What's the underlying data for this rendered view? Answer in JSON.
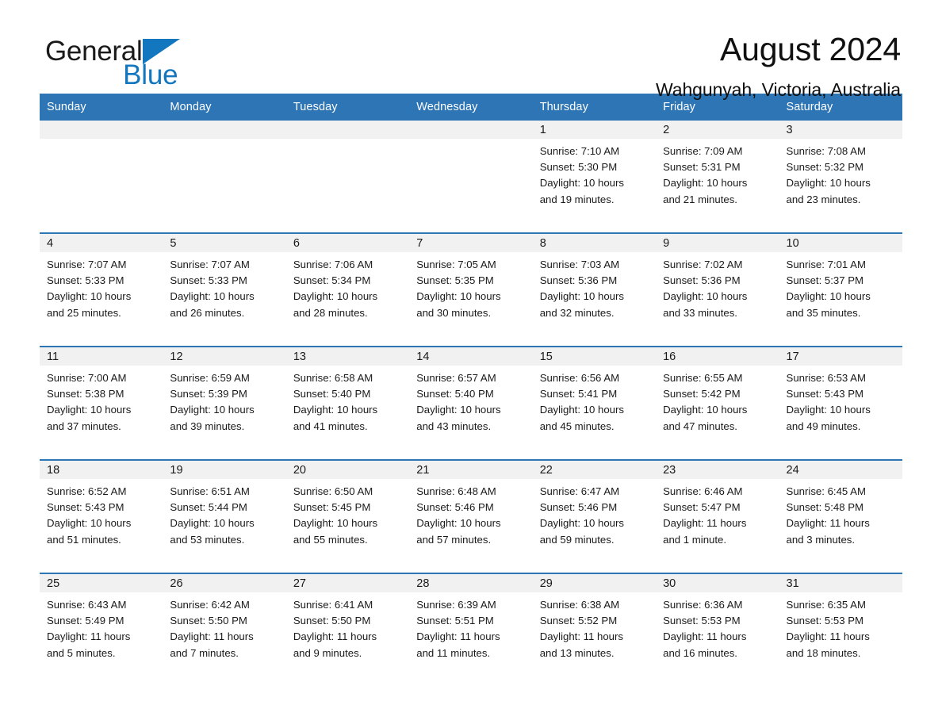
{
  "brand": {
    "name_part1": "General",
    "name_part2": "Blue",
    "triangle_color": "#1277be",
    "accent_color": "#2e75b6"
  },
  "header": {
    "month_title": "August 2024",
    "location": "Wahgunyah, Victoria, Australia"
  },
  "weekdays": [
    "Sunday",
    "Monday",
    "Tuesday",
    "Wednesday",
    "Thursday",
    "Friday",
    "Saturday"
  ],
  "weeks": [
    [
      {
        "day": "",
        "empty": true
      },
      {
        "day": "",
        "empty": true
      },
      {
        "day": "",
        "empty": true
      },
      {
        "day": "",
        "empty": true
      },
      {
        "day": "1",
        "sunrise": "Sunrise: 7:10 AM",
        "sunset": "Sunset: 5:30 PM",
        "daylight_line1": "Daylight: 10 hours",
        "daylight_line2": "and 19 minutes."
      },
      {
        "day": "2",
        "sunrise": "Sunrise: 7:09 AM",
        "sunset": "Sunset: 5:31 PM",
        "daylight_line1": "Daylight: 10 hours",
        "daylight_line2": "and 21 minutes."
      },
      {
        "day": "3",
        "sunrise": "Sunrise: 7:08 AM",
        "sunset": "Sunset: 5:32 PM",
        "daylight_line1": "Daylight: 10 hours",
        "daylight_line2": "and 23 minutes."
      }
    ],
    [
      {
        "day": "4",
        "sunrise": "Sunrise: 7:07 AM",
        "sunset": "Sunset: 5:33 PM",
        "daylight_line1": "Daylight: 10 hours",
        "daylight_line2": "and 25 minutes."
      },
      {
        "day": "5",
        "sunrise": "Sunrise: 7:07 AM",
        "sunset": "Sunset: 5:33 PM",
        "daylight_line1": "Daylight: 10 hours",
        "daylight_line2": "and 26 minutes."
      },
      {
        "day": "6",
        "sunrise": "Sunrise: 7:06 AM",
        "sunset": "Sunset: 5:34 PM",
        "daylight_line1": "Daylight: 10 hours",
        "daylight_line2": "and 28 minutes."
      },
      {
        "day": "7",
        "sunrise": "Sunrise: 7:05 AM",
        "sunset": "Sunset: 5:35 PM",
        "daylight_line1": "Daylight: 10 hours",
        "daylight_line2": "and 30 minutes."
      },
      {
        "day": "8",
        "sunrise": "Sunrise: 7:03 AM",
        "sunset": "Sunset: 5:36 PM",
        "daylight_line1": "Daylight: 10 hours",
        "daylight_line2": "and 32 minutes."
      },
      {
        "day": "9",
        "sunrise": "Sunrise: 7:02 AM",
        "sunset": "Sunset: 5:36 PM",
        "daylight_line1": "Daylight: 10 hours",
        "daylight_line2": "and 33 minutes."
      },
      {
        "day": "10",
        "sunrise": "Sunrise: 7:01 AM",
        "sunset": "Sunset: 5:37 PM",
        "daylight_line1": "Daylight: 10 hours",
        "daylight_line2": "and 35 minutes."
      }
    ],
    [
      {
        "day": "11",
        "sunrise": "Sunrise: 7:00 AM",
        "sunset": "Sunset: 5:38 PM",
        "daylight_line1": "Daylight: 10 hours",
        "daylight_line2": "and 37 minutes."
      },
      {
        "day": "12",
        "sunrise": "Sunrise: 6:59 AM",
        "sunset": "Sunset: 5:39 PM",
        "daylight_line1": "Daylight: 10 hours",
        "daylight_line2": "and 39 minutes."
      },
      {
        "day": "13",
        "sunrise": "Sunrise: 6:58 AM",
        "sunset": "Sunset: 5:40 PM",
        "daylight_line1": "Daylight: 10 hours",
        "daylight_line2": "and 41 minutes."
      },
      {
        "day": "14",
        "sunrise": "Sunrise: 6:57 AM",
        "sunset": "Sunset: 5:40 PM",
        "daylight_line1": "Daylight: 10 hours",
        "daylight_line2": "and 43 minutes."
      },
      {
        "day": "15",
        "sunrise": "Sunrise: 6:56 AM",
        "sunset": "Sunset: 5:41 PM",
        "daylight_line1": "Daylight: 10 hours",
        "daylight_line2": "and 45 minutes."
      },
      {
        "day": "16",
        "sunrise": "Sunrise: 6:55 AM",
        "sunset": "Sunset: 5:42 PM",
        "daylight_line1": "Daylight: 10 hours",
        "daylight_line2": "and 47 minutes."
      },
      {
        "day": "17",
        "sunrise": "Sunrise: 6:53 AM",
        "sunset": "Sunset: 5:43 PM",
        "daylight_line1": "Daylight: 10 hours",
        "daylight_line2": "and 49 minutes."
      }
    ],
    [
      {
        "day": "18",
        "sunrise": "Sunrise: 6:52 AM",
        "sunset": "Sunset: 5:43 PM",
        "daylight_line1": "Daylight: 10 hours",
        "daylight_line2": "and 51 minutes."
      },
      {
        "day": "19",
        "sunrise": "Sunrise: 6:51 AM",
        "sunset": "Sunset: 5:44 PM",
        "daylight_line1": "Daylight: 10 hours",
        "daylight_line2": "and 53 minutes."
      },
      {
        "day": "20",
        "sunrise": "Sunrise: 6:50 AM",
        "sunset": "Sunset: 5:45 PM",
        "daylight_line1": "Daylight: 10 hours",
        "daylight_line2": "and 55 minutes."
      },
      {
        "day": "21",
        "sunrise": "Sunrise: 6:48 AM",
        "sunset": "Sunset: 5:46 PM",
        "daylight_line1": "Daylight: 10 hours",
        "daylight_line2": "and 57 minutes."
      },
      {
        "day": "22",
        "sunrise": "Sunrise: 6:47 AM",
        "sunset": "Sunset: 5:46 PM",
        "daylight_line1": "Daylight: 10 hours",
        "daylight_line2": "and 59 minutes."
      },
      {
        "day": "23",
        "sunrise": "Sunrise: 6:46 AM",
        "sunset": "Sunset: 5:47 PM",
        "daylight_line1": "Daylight: 11 hours",
        "daylight_line2": "and 1 minute."
      },
      {
        "day": "24",
        "sunrise": "Sunrise: 6:45 AM",
        "sunset": "Sunset: 5:48 PM",
        "daylight_line1": "Daylight: 11 hours",
        "daylight_line2": "and 3 minutes."
      }
    ],
    [
      {
        "day": "25",
        "sunrise": "Sunrise: 6:43 AM",
        "sunset": "Sunset: 5:49 PM",
        "daylight_line1": "Daylight: 11 hours",
        "daylight_line2": "and 5 minutes."
      },
      {
        "day": "26",
        "sunrise": "Sunrise: 6:42 AM",
        "sunset": "Sunset: 5:50 PM",
        "daylight_line1": "Daylight: 11 hours",
        "daylight_line2": "and 7 minutes."
      },
      {
        "day": "27",
        "sunrise": "Sunrise: 6:41 AM",
        "sunset": "Sunset: 5:50 PM",
        "daylight_line1": "Daylight: 11 hours",
        "daylight_line2": "and 9 minutes."
      },
      {
        "day": "28",
        "sunrise": "Sunrise: 6:39 AM",
        "sunset": "Sunset: 5:51 PM",
        "daylight_line1": "Daylight: 11 hours",
        "daylight_line2": "and 11 minutes."
      },
      {
        "day": "29",
        "sunrise": "Sunrise: 6:38 AM",
        "sunset": "Sunset: 5:52 PM",
        "daylight_line1": "Daylight: 11 hours",
        "daylight_line2": "and 13 minutes."
      },
      {
        "day": "30",
        "sunrise": "Sunrise: 6:36 AM",
        "sunset": "Sunset: 5:53 PM",
        "daylight_line1": "Daylight: 11 hours",
        "daylight_line2": "and 16 minutes."
      },
      {
        "day": "31",
        "sunrise": "Sunrise: 6:35 AM",
        "sunset": "Sunset: 5:53 PM",
        "daylight_line1": "Daylight: 11 hours",
        "daylight_line2": "and 18 minutes."
      }
    ]
  ]
}
